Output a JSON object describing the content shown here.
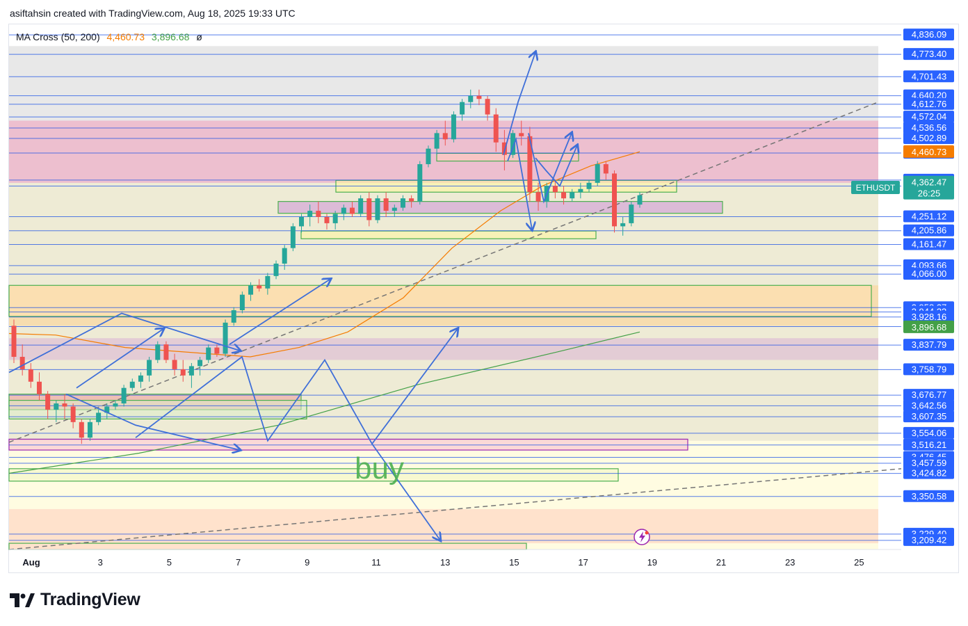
{
  "header": {
    "text": "asiftahsin created with TradingView.com, Aug 18, 2025 19:33 UTC"
  },
  "indicator": {
    "name": "MA Cross (50, 200)",
    "ma50": "4,460.73",
    "ma200": "3,896.68",
    "symbol": "ø"
  },
  "symbol_tag": {
    "label": "ETHUSDT"
  },
  "annotation": {
    "text": "buy"
  },
  "footer": {
    "brand": "TradingView"
  },
  "colors": {
    "up": "#26a69a",
    "down": "#ef5350",
    "accent": "#2962ff",
    "ma50": "#f57c00",
    "ma200": "#43a047",
    "line": "#1e53e5"
  },
  "chart_data": {
    "type": "candlestick",
    "ylim": [
      3180,
      4870
    ],
    "x_ticks": [
      "Aug",
      "3",
      "5",
      "7",
      "9",
      "11",
      "13",
      "15",
      "17",
      "19",
      "21",
      "23",
      "25"
    ],
    "price_levels": [
      "4,836.09",
      "4,773.40",
      "4,701.43",
      "4,640.20",
      "4,612.76",
      "4,572.04",
      "4,536.56",
      "4,502.89",
      "4,455.98",
      "4,368.79",
      "4,349.46",
      "4,251.12",
      "4,205.86",
      "4,161.47",
      "4,093.66",
      "4,066.00",
      "3,958.27",
      "3,944.33",
      "3,928.16",
      "3,897.47",
      "3,837.79",
      "3,758.79",
      "3,676.77",
      "3,642.56",
      "3,607.35",
      "3,554.06",
      "3,516.21",
      "3,476.45",
      "3,457.59",
      "3,424.82",
      "3,350.58",
      "3,229.40",
      "3,209.42"
    ],
    "highlight_labels": [
      {
        "text": "4,460.73",
        "value": 4460.73,
        "color": "#f57c00"
      },
      {
        "text": "4,362.47",
        "value": 4362.47,
        "color": "#26a69a",
        "sub": "26:25"
      },
      {
        "text": "3,896.68",
        "value": 3896.68,
        "color": "#43a047"
      }
    ],
    "candles": [
      [
        3900,
        3920,
        3780,
        3800
      ],
      [
        3800,
        3840,
        3740,
        3760
      ],
      [
        3760,
        3780,
        3700,
        3720
      ],
      [
        3720,
        3750,
        3660,
        3680
      ],
      [
        3680,
        3690,
        3600,
        3630
      ],
      [
        3630,
        3660,
        3590,
        3650
      ],
      [
        3650,
        3680,
        3600,
        3640
      ],
      [
        3640,
        3650,
        3570,
        3590
      ],
      [
        3590,
        3600,
        3520,
        3540
      ],
      [
        3540,
        3600,
        3530,
        3590
      ],
      [
        3590,
        3630,
        3580,
        3620
      ],
      [
        3620,
        3650,
        3600,
        3640
      ],
      [
        3640,
        3660,
        3630,
        3650
      ],
      [
        3650,
        3710,
        3640,
        3700
      ],
      [
        3700,
        3730,
        3690,
        3720
      ],
      [
        3720,
        3750,
        3700,
        3740
      ],
      [
        3740,
        3800,
        3720,
        3790
      ],
      [
        3790,
        3850,
        3780,
        3840
      ],
      [
        3840,
        3850,
        3780,
        3790
      ],
      [
        3790,
        3810,
        3740,
        3760
      ],
      [
        3760,
        3790,
        3720,
        3740
      ],
      [
        3740,
        3780,
        3700,
        3770
      ],
      [
        3770,
        3800,
        3740,
        3790
      ],
      [
        3790,
        3840,
        3780,
        3830
      ],
      [
        3830,
        3840,
        3800,
        3810
      ],
      [
        3810,
        3920,
        3800,
        3910
      ],
      [
        3910,
        3960,
        3900,
        3950
      ],
      [
        3950,
        4010,
        3940,
        4000
      ],
      [
        4000,
        4040,
        3980,
        4030
      ],
      [
        4030,
        4050,
        4010,
        4020
      ],
      [
        4020,
        4070,
        4000,
        4060
      ],
      [
        4060,
        4110,
        4050,
        4100
      ],
      [
        4100,
        4160,
        4080,
        4150
      ],
      [
        4150,
        4230,
        4140,
        4220
      ],
      [
        4220,
        4260,
        4200,
        4250
      ],
      [
        4250,
        4290,
        4220,
        4270
      ],
      [
        4270,
        4300,
        4230,
        4250
      ],
      [
        4250,
        4260,
        4210,
        4230
      ],
      [
        4230,
        4270,
        4210,
        4260
      ],
      [
        4260,
        4290,
        4240,
        4280
      ],
      [
        4280,
        4300,
        4250,
        4260
      ],
      [
        4260,
        4320,
        4250,
        4310
      ],
      [
        4310,
        4330,
        4220,
        4240
      ],
      [
        4240,
        4320,
        4230,
        4310
      ],
      [
        4310,
        4330,
        4250,
        4270
      ],
      [
        4270,
        4290,
        4250,
        4280
      ],
      [
        4280,
        4320,
        4270,
        4310
      ],
      [
        4310,
        4320,
        4280,
        4300
      ],
      [
        4300,
        4430,
        4290,
        4420
      ],
      [
        4420,
        4480,
        4410,
        4470
      ],
      [
        4470,
        4530,
        4450,
        4520
      ],
      [
        4520,
        4560,
        4480,
        4500
      ],
      [
        4500,
        4590,
        4490,
        4580
      ],
      [
        4580,
        4630,
        4560,
        4620
      ],
      [
        4620,
        4660,
        4600,
        4640
      ],
      [
        4640,
        4660,
        4610,
        4630
      ],
      [
        4630,
        4640,
        4560,
        4580
      ],
      [
        4580,
        4600,
        4460,
        4490
      ],
      [
        4490,
        4530,
        4400,
        4450
      ],
      [
        4450,
        4530,
        4440,
        4520
      ],
      [
        4520,
        4560,
        4480,
        4510
      ],
      [
        4510,
        4540,
        4300,
        4330
      ],
      [
        4330,
        4360,
        4270,
        4300
      ],
      [
        4300,
        4360,
        4280,
        4350
      ],
      [
        4350,
        4370,
        4310,
        4330
      ],
      [
        4330,
        4350,
        4290,
        4310
      ],
      [
        4310,
        4340,
        4300,
        4330
      ],
      [
        4330,
        4360,
        4310,
        4340
      ],
      [
        4340,
        4370,
        4330,
        4360
      ],
      [
        4360,
        4430,
        4350,
        4420
      ],
      [
        4420,
        4430,
        4370,
        4390
      ],
      [
        4390,
        4400,
        4200,
        4220
      ],
      [
        4220,
        4250,
        4190,
        4230
      ],
      [
        4230,
        4300,
        4220,
        4290
      ],
      [
        4290,
        4330,
        4280,
        4320
      ]
    ]
  }
}
